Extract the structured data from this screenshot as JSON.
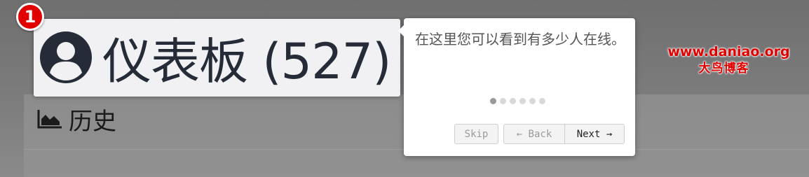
{
  "step_badge": "1",
  "dashboard": {
    "title": "仪表板 (527)",
    "icon": "user-circle-icon"
  },
  "history": {
    "title": "历史",
    "icon": "area-chart-icon"
  },
  "tour": {
    "text": "在这里您可以看到有多少人在线。",
    "steps_total": 6,
    "current_step": 1,
    "skip_label": "Skip",
    "back_label": "← Back",
    "next_label": "Next →"
  },
  "watermark": {
    "url": "www.daniao.org",
    "name": "大鸟博客"
  },
  "colors": {
    "badge": "#e00000",
    "watermark": "#e00000",
    "title": "#252b37"
  }
}
